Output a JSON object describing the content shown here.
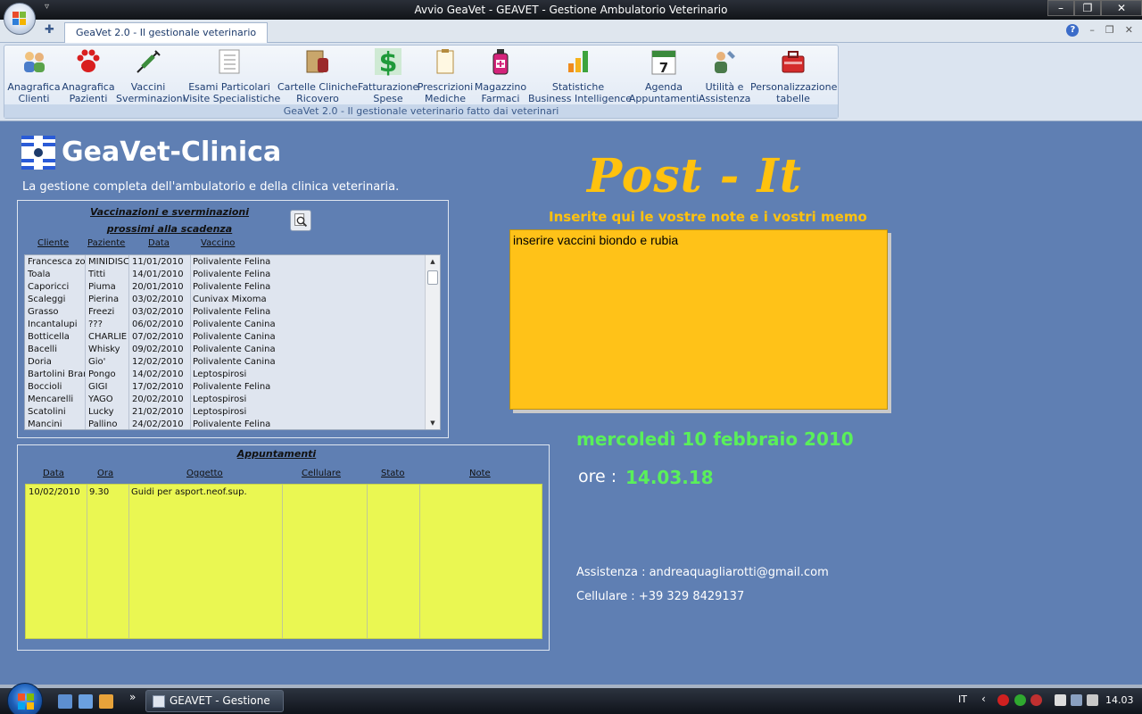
{
  "window": {
    "title": "Avvio GeaVet - GEAVET - Gestione Ambulatorio Veterinario",
    "tab": "GeaVet 2.0 - Il gestionale veterinario"
  },
  "ribbon": {
    "caption": "GeaVet 2.0 - Il gestionale veterinario fatto dai veterinari",
    "buttons": [
      {
        "line1": "Anagrafica",
        "line2": "Clienti"
      },
      {
        "line1": "Anagrafica",
        "line2": "Pazienti"
      },
      {
        "line1": "Vaccini",
        "line2": "Sverminazioni"
      },
      {
        "line1": "Esami Particolari",
        "line2": "Visite Specialistiche"
      },
      {
        "line1": "Cartelle Cliniche",
        "line2": "Ricovero"
      },
      {
        "line1": "Fatturazione",
        "line2": "Spese"
      },
      {
        "line1": "Prescrizioni",
        "line2": "Mediche"
      },
      {
        "line1": "Magazzino",
        "line2": "Farmaci"
      },
      {
        "line1": "Statistiche",
        "line2": "Business Intelligence"
      },
      {
        "line1": "Agenda",
        "line2": "Appuntamenti"
      },
      {
        "line1": "Utilità e",
        "line2": "Assistenza"
      },
      {
        "line1": "Personalizzazione",
        "line2": "tabelle"
      }
    ]
  },
  "brand": {
    "title": "GeaVet-Clinica",
    "subtitle": "La gestione completa dell'ambulatorio e della clinica veterinaria."
  },
  "vaccinations": {
    "title_line1": "Vaccinazioni e sverminazioni",
    "title_line2": "prossimi alla scadenza",
    "columns": [
      "Cliente",
      "Paziente",
      "Data",
      "Vaccino"
    ],
    "rows": [
      [
        "Francesca zoc",
        "MINIDISC",
        "11/01/2010",
        "Polivalente Felina"
      ],
      [
        "Toala",
        "Titti",
        "14/01/2010",
        "Polivalente Felina"
      ],
      [
        "Caporicci",
        "Piuma",
        "20/01/2010",
        "Polivalente Felina"
      ],
      [
        "Scaleggi",
        "Pierina",
        "03/02/2010",
        "Cunivax Mixoma"
      ],
      [
        "Grasso",
        "Freezi",
        "03/02/2010",
        "Polivalente Felina"
      ],
      [
        "Incantalupi",
        "???",
        "06/02/2010",
        "Polivalente Canina"
      ],
      [
        "Botticella",
        "CHARLIE",
        "07/02/2010",
        "Polivalente Canina"
      ],
      [
        "Bacelli",
        "Whisky",
        "09/02/2010",
        "Polivalente Canina"
      ],
      [
        "Doria",
        "Gio'",
        "12/02/2010",
        "Polivalente Canina"
      ],
      [
        "Bartolini Bran",
        "Pongo",
        "14/02/2010",
        "Leptospirosi"
      ],
      [
        "Boccioli",
        "GIGI",
        "17/02/2010",
        "Polivalente Felina"
      ],
      [
        "Mencarelli",
        "YAGO",
        "20/02/2010",
        "Leptospirosi"
      ],
      [
        "Scatolini",
        "Lucky",
        "21/02/2010",
        "Leptospirosi"
      ],
      [
        "Mancini",
        "Pallino",
        "24/02/2010",
        "Polivalente Felina"
      ]
    ]
  },
  "appointments": {
    "title": "Appuntamenti",
    "columns": [
      "Data",
      "Ora",
      "Oggetto",
      "Cellulare",
      "Stato",
      "Note"
    ],
    "rows": [
      [
        "10/02/2010",
        "9.30",
        "Guidi per asport.neof.sup.",
        "",
        "",
        ""
      ]
    ]
  },
  "postit": {
    "title": "Post - It",
    "subtitle": "Inserite qui le vostre note e i vostri memo",
    "note": "inserire vaccini biondo e rubia"
  },
  "info": {
    "date": "mercoledì 10 febbraio 2010",
    "time_label": "ore :",
    "time": "14.03.18",
    "assistance": "Assistenza : andreaquagliarotti@gmail.com",
    "phone": "Cellulare : +39 329 8429137"
  },
  "taskbar": {
    "task_label": "GEAVET - Gestione ...",
    "lang": "IT",
    "clock": "14.03",
    "chevron": "»"
  },
  "colors": {
    "background": "#5f7fb3",
    "postit": "#ffc218",
    "postit_title": "#ffc20e",
    "date_green": "#5af05a",
    "appointments_bg": "#eaf752"
  }
}
